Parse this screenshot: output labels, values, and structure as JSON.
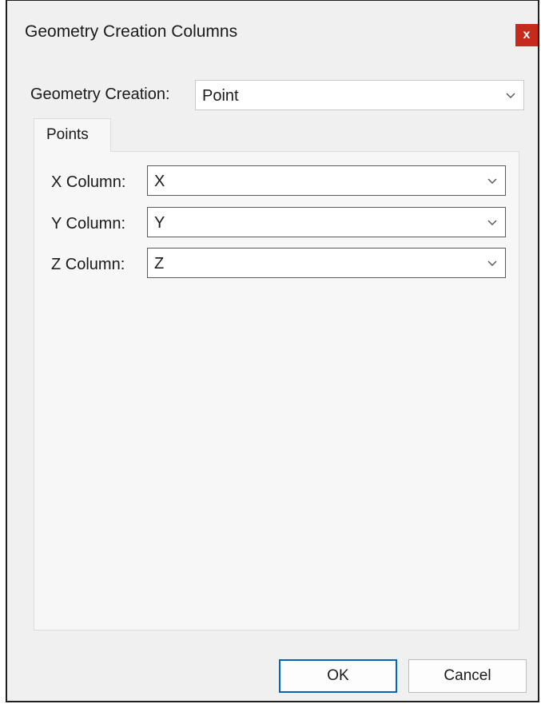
{
  "window": {
    "title": "Geometry Creation Columns",
    "close_label": "x"
  },
  "geometry": {
    "label": "Geometry Creation:",
    "value": "Point"
  },
  "tabs": [
    {
      "label": "Points"
    }
  ],
  "points": {
    "x": {
      "label": "X Column:",
      "value": "X"
    },
    "y": {
      "label": "Y Column:",
      "value": "Y"
    },
    "z": {
      "label": "Z Column:",
      "value": "Z"
    }
  },
  "buttons": {
    "ok": "OK",
    "cancel": "Cancel"
  },
  "colors": {
    "close": "#c42b1c",
    "ok_border": "#0067c0",
    "background": "#f0f0f0"
  }
}
